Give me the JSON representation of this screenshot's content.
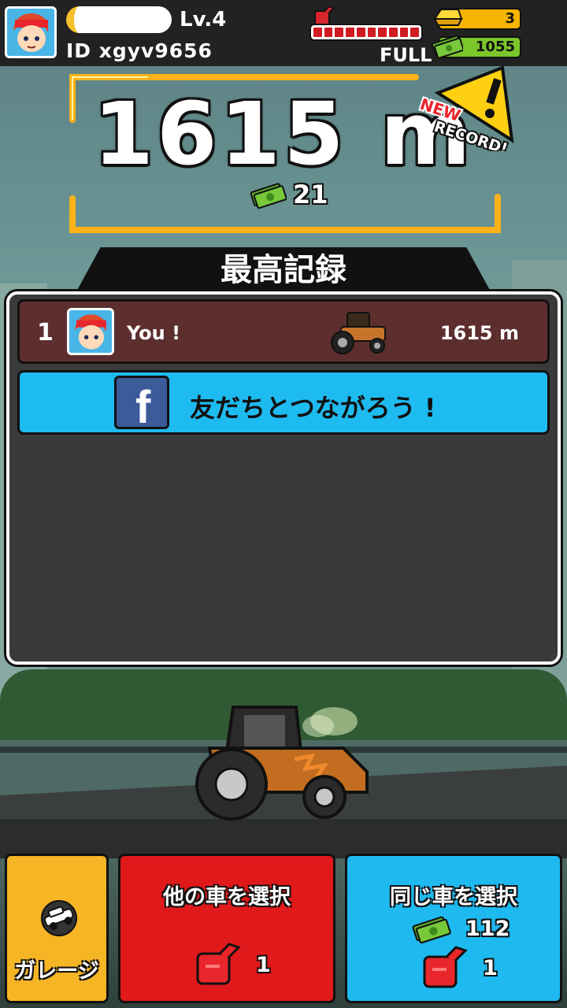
{
  "player": {
    "level": "Lv.4",
    "id_text": "ID xgyv9656"
  },
  "fuel": {
    "segments": 10,
    "filled": 10,
    "label": "FULL"
  },
  "currency": {
    "gold": "3",
    "cash": "1055"
  },
  "result": {
    "distance": "1615 m",
    "reward": "21",
    "badge_new": "NEW",
    "badge_record": "RECORD!"
  },
  "leaderboard": {
    "title": "最高記録",
    "entries": [
      {
        "rank": "1",
        "name": "You !",
        "distance": "1615 m"
      }
    ],
    "facebook_prompt": "友だちとつながろう !"
  },
  "buttons": {
    "garage": "ガレージ",
    "other_car": {
      "label": "他の車を選択",
      "fuel_cost": "1"
    },
    "same_car": {
      "label": "同じ車を選択",
      "cash_cost": "112",
      "fuel_cost": "1"
    }
  },
  "colors": {
    "accent_gold": "#f5b525",
    "danger_red": "#e0191b",
    "sky_blue": "#1eb9ef",
    "row_maroon": "#5d2e2e"
  },
  "icons": [
    "avatar-icon",
    "fuel-can-icon",
    "gold-bar-icon",
    "cash-icon",
    "new-record-icon",
    "tractor-icon",
    "facebook-icon",
    "garage-car-icon"
  ]
}
